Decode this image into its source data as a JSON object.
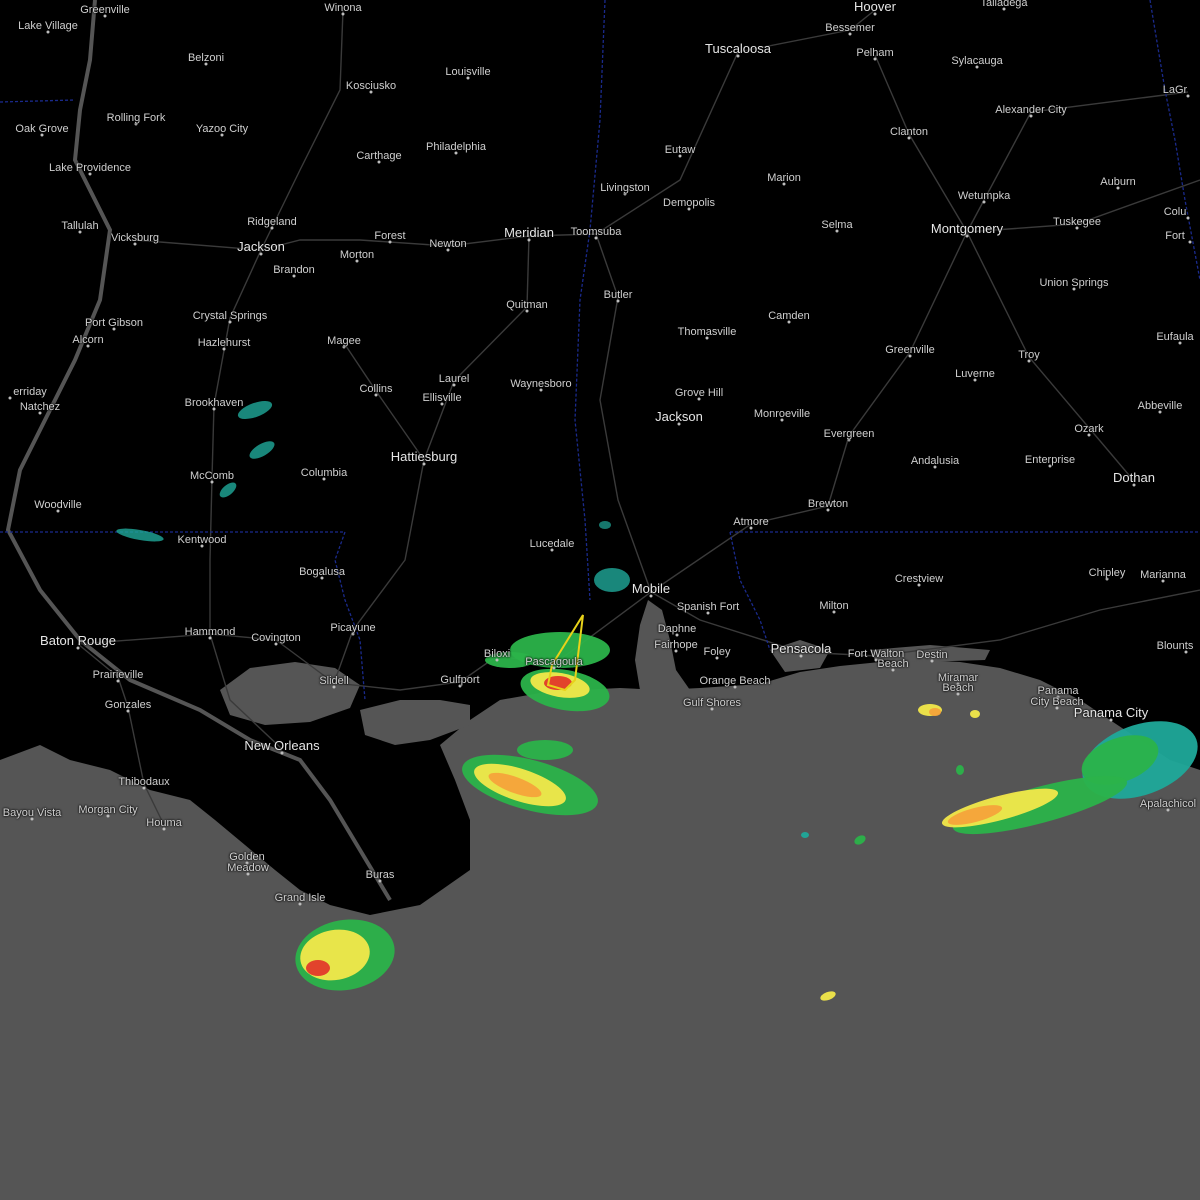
{
  "colors": {
    "land": "#000000",
    "water": "#555555",
    "roads": "#3a3a3a",
    "state_border": "#1a2a8c",
    "warning_polygon": "#e8d21a",
    "radar_light": "#1fa99a",
    "radar_green": "#2bb34a",
    "radar_yellow": "#f2e84a",
    "radar_orange": "#f5a33a",
    "radar_red": "#e23a2a"
  },
  "cities": [
    {
      "name": "Greenville"
    },
    {
      "name": "Winona"
    },
    {
      "name": "Hoover"
    },
    {
      "name": "Talladega"
    },
    {
      "name": "Lake Village"
    },
    {
      "name": "Bessemer"
    },
    {
      "name": "Tuscaloosa"
    },
    {
      "name": "Belzoni"
    },
    {
      "name": "Louisville"
    },
    {
      "name": "Pelham"
    },
    {
      "name": "Sylacauga"
    },
    {
      "name": "Kosciusko"
    },
    {
      "name": "LaGr"
    },
    {
      "name": "Rolling Fork"
    },
    {
      "name": "Alexander City"
    },
    {
      "name": "Oak Grove"
    },
    {
      "name": "Yazoo City"
    },
    {
      "name": "Clanton"
    },
    {
      "name": "Philadelphia"
    },
    {
      "name": "Eutaw"
    },
    {
      "name": "Lake Providence"
    },
    {
      "name": "Carthage"
    },
    {
      "name": "Marion"
    },
    {
      "name": "Auburn"
    },
    {
      "name": "Livingston"
    },
    {
      "name": "Wetumpka"
    },
    {
      "name": "Demopolis"
    },
    {
      "name": "Colu"
    },
    {
      "name": "Ridgeland"
    },
    {
      "name": "Tuskegee"
    },
    {
      "name": "Tallulah"
    },
    {
      "name": "Selma"
    },
    {
      "name": "Forest"
    },
    {
      "name": "Meridian"
    },
    {
      "name": "Toomsuba"
    },
    {
      "name": "Montgomery"
    },
    {
      "name": "Fort"
    },
    {
      "name": "Vicksburg"
    },
    {
      "name": "Jackson"
    },
    {
      "name": "Newton"
    },
    {
      "name": "Morton"
    },
    {
      "name": "Brandon"
    },
    {
      "name": "Union Springs"
    },
    {
      "name": "Butler"
    },
    {
      "name": "Quitman"
    },
    {
      "name": "Camden"
    },
    {
      "name": "Crystal Springs"
    },
    {
      "name": "Port Gibson"
    },
    {
      "name": "Thomasville"
    },
    {
      "name": "Eufaula"
    },
    {
      "name": "Magee"
    },
    {
      "name": "Alcorn"
    },
    {
      "name": "Hazlehurst"
    },
    {
      "name": "Greenville"
    },
    {
      "name": "Troy"
    },
    {
      "name": "Laurel"
    },
    {
      "name": "Waynesboro"
    },
    {
      "name": "Luverne"
    },
    {
      "name": "Collins"
    },
    {
      "name": "Grove Hill"
    },
    {
      "name": "Ellisville"
    },
    {
      "name": "erriday"
    },
    {
      "name": "Brookhaven"
    },
    {
      "name": "Natchez"
    },
    {
      "name": "Abbeville"
    },
    {
      "name": "Monroeville"
    },
    {
      "name": "Jackson"
    },
    {
      "name": "Ozark"
    },
    {
      "name": "Evergreen"
    },
    {
      "name": "Hattiesburg"
    },
    {
      "name": "Andalusia"
    },
    {
      "name": "Enterprise"
    },
    {
      "name": "Columbia"
    },
    {
      "name": "McComb"
    },
    {
      "name": "Dothan"
    },
    {
      "name": "Woodville"
    },
    {
      "name": "Brewton"
    },
    {
      "name": "Atmore"
    },
    {
      "name": "Kentwood"
    },
    {
      "name": "Lucedale"
    },
    {
      "name": "Bogalusa"
    },
    {
      "name": "Crestview"
    },
    {
      "name": "Chipley"
    },
    {
      "name": "Marianna"
    },
    {
      "name": "Mobile"
    },
    {
      "name": "Spanish Fort"
    },
    {
      "name": "Milton"
    },
    {
      "name": "Picayune"
    },
    {
      "name": "Daphne"
    },
    {
      "name": "Baton Rouge"
    },
    {
      "name": "Hammond"
    },
    {
      "name": "Covington"
    },
    {
      "name": "Blounts"
    },
    {
      "name": "Fairhope"
    },
    {
      "name": "Pensacola"
    },
    {
      "name": "Fort Walton"
    },
    {
      "name": "Beach"
    },
    {
      "name": "Destin"
    },
    {
      "name": "Biloxi"
    },
    {
      "name": "Pascagoula"
    },
    {
      "name": "Foley"
    },
    {
      "name": "Prairieville"
    },
    {
      "name": "Gulfport"
    },
    {
      "name": "Slidell"
    },
    {
      "name": "Miramar"
    },
    {
      "name": "Beach"
    },
    {
      "name": "Orange Beach"
    },
    {
      "name": "Gonzales"
    },
    {
      "name": "Gulf Shores"
    },
    {
      "name": "Panama"
    },
    {
      "name": "City Beach"
    },
    {
      "name": "Panama City"
    },
    {
      "name": "New Orleans"
    },
    {
      "name": "Thibodaux"
    },
    {
      "name": "Apalachicol"
    },
    {
      "name": "Bayou Vista"
    },
    {
      "name": "Morgan City"
    },
    {
      "name": "Houma"
    },
    {
      "name": "Golden"
    },
    {
      "name": "Meadow"
    },
    {
      "name": "Buras"
    },
    {
      "name": "Grand Isle"
    }
  ]
}
